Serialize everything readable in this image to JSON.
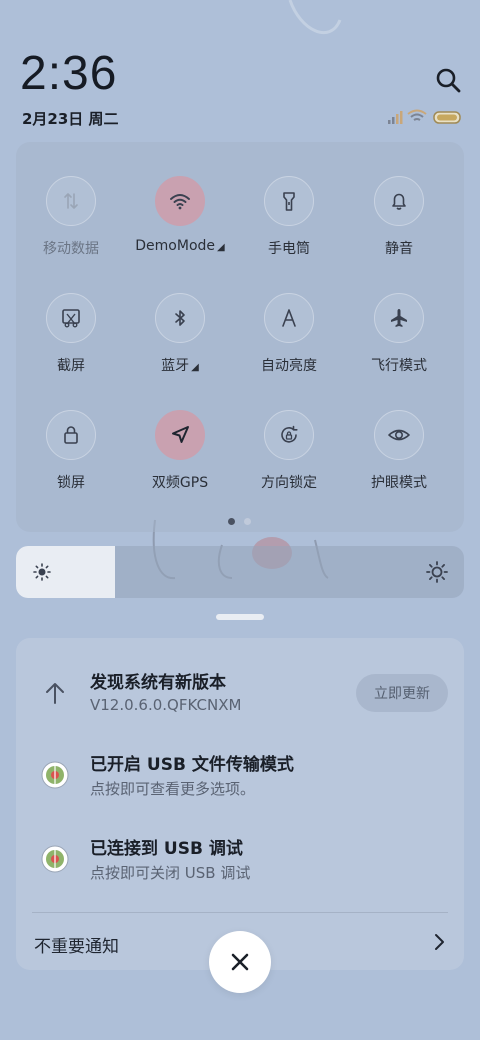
{
  "header": {
    "time": "2:36",
    "date": "2月23日 周二",
    "search_icon": "search-icon"
  },
  "status": {
    "icons": [
      "signal-icon",
      "wifi-icon",
      "battery-icon"
    ]
  },
  "quick_settings": {
    "tiles": [
      {
        "label": "移动数据",
        "icon": "mobile-data-icon",
        "active": false,
        "dim": true
      },
      {
        "label": "DemoMode",
        "icon": "wifi-icon",
        "active": true,
        "has_arrow": true
      },
      {
        "label": "手电筒",
        "icon": "flashlight-icon",
        "active": false
      },
      {
        "label": "静音",
        "icon": "bell-icon",
        "active": false
      },
      {
        "label": "截屏",
        "icon": "screenshot-icon",
        "active": false
      },
      {
        "label": "蓝牙",
        "icon": "bluetooth-icon",
        "active": false,
        "has_arrow": true
      },
      {
        "label": "自动亮度",
        "icon": "auto-brightness-icon",
        "active": false
      },
      {
        "label": "飞行模式",
        "icon": "airplane-icon",
        "active": false
      },
      {
        "label": "锁屏",
        "icon": "lock-icon",
        "active": false
      },
      {
        "label": "双频GPS",
        "icon": "gps-icon",
        "active": true
      },
      {
        "label": "方向锁定",
        "icon": "rotation-lock-icon",
        "active": false
      },
      {
        "label": "护眼模式",
        "icon": "eye-icon",
        "active": false
      }
    ],
    "page_count": 2,
    "current_page": 1
  },
  "brightness": {
    "level": 0.22
  },
  "notifications": {
    "items": [
      {
        "title": "发现系统有新版本",
        "subtitle": "V12.0.6.0.QFKCNXM",
        "button": "立即更新",
        "icon": "update-arrow-icon"
      },
      {
        "title": "已开启 USB 文件传输模式",
        "subtitle": "点按即可查看更多选项。",
        "icon": "android-system-icon"
      },
      {
        "title": "已连接到 USB 调试",
        "subtitle": "点按即可关闭 USB 调试",
        "icon": "android-system-icon"
      }
    ],
    "unimportant_label": "不重要通知"
  },
  "colors": {
    "background": "#aebfd8",
    "active_tile": "#c9a1b0",
    "panel": "#a5b4cb"
  }
}
